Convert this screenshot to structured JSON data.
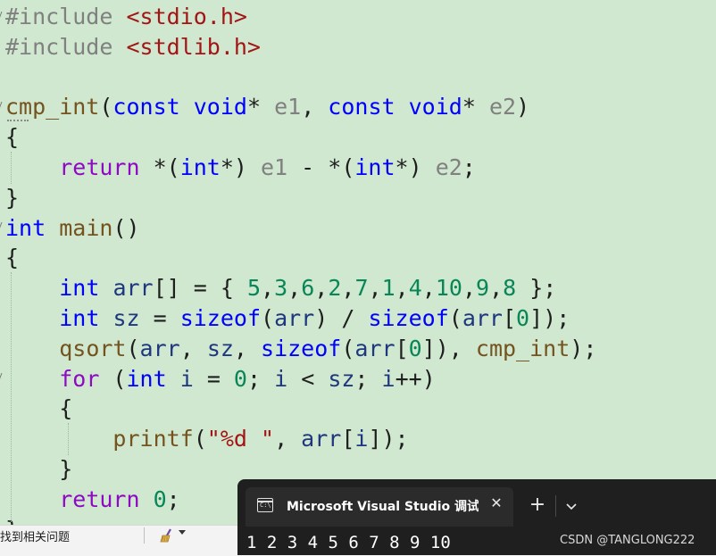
{
  "editor": {
    "lines": [
      [
        {
          "t": "#include ",
          "c": "pp"
        },
        {
          "t": "<stdio.h>",
          "c": "inc"
        }
      ],
      [
        {
          "t": "#include ",
          "c": "pp"
        },
        {
          "t": "<stdlib.h>",
          "c": "inc"
        }
      ],
      [],
      [
        {
          "t": "cmp_int",
          "c": "fn"
        },
        {
          "t": "(",
          "c": "op"
        },
        {
          "t": "const",
          "c": "kw"
        },
        {
          "t": " ",
          "c": "op"
        },
        {
          "t": "void",
          "c": "kw"
        },
        {
          "t": "* ",
          "c": "op"
        },
        {
          "t": "e1",
          "c": "param"
        },
        {
          "t": ", ",
          "c": "op"
        },
        {
          "t": "const",
          "c": "kw"
        },
        {
          "t": " ",
          "c": "op"
        },
        {
          "t": "void",
          "c": "kw"
        },
        {
          "t": "* ",
          "c": "op"
        },
        {
          "t": "e2",
          "c": "param"
        },
        {
          "t": ")",
          "c": "op"
        }
      ],
      [
        {
          "t": "{",
          "c": "op"
        }
      ],
      [
        {
          "t": "    ",
          "c": "op"
        },
        {
          "t": "return",
          "c": "ctl"
        },
        {
          "t": " *(",
          "c": "op"
        },
        {
          "t": "int",
          "c": "kw"
        },
        {
          "t": "*) ",
          "c": "op"
        },
        {
          "t": "e1",
          "c": "param"
        },
        {
          "t": " - *(",
          "c": "op"
        },
        {
          "t": "int",
          "c": "kw"
        },
        {
          "t": "*) ",
          "c": "op"
        },
        {
          "t": "e2",
          "c": "param"
        },
        {
          "t": ";",
          "c": "op"
        }
      ],
      [
        {
          "t": "}",
          "c": "op"
        }
      ],
      [
        {
          "t": "int",
          "c": "kw"
        },
        {
          "t": " ",
          "c": "op"
        },
        {
          "t": "main",
          "c": "fn"
        },
        {
          "t": "()",
          "c": "op"
        }
      ],
      [
        {
          "t": "{",
          "c": "op"
        }
      ],
      [
        {
          "t": "    ",
          "c": "op"
        },
        {
          "t": "int",
          "c": "kw"
        },
        {
          "t": " ",
          "c": "op"
        },
        {
          "t": "arr",
          "c": "var"
        },
        {
          "t": "[] = { ",
          "c": "op"
        },
        {
          "t": "5",
          "c": "num"
        },
        {
          "t": ",",
          "c": "op"
        },
        {
          "t": "3",
          "c": "num"
        },
        {
          "t": ",",
          "c": "op"
        },
        {
          "t": "6",
          "c": "num"
        },
        {
          "t": ",",
          "c": "op"
        },
        {
          "t": "2",
          "c": "num"
        },
        {
          "t": ",",
          "c": "op"
        },
        {
          "t": "7",
          "c": "num"
        },
        {
          "t": ",",
          "c": "op"
        },
        {
          "t": "1",
          "c": "num"
        },
        {
          "t": ",",
          "c": "op"
        },
        {
          "t": "4",
          "c": "num"
        },
        {
          "t": ",",
          "c": "op"
        },
        {
          "t": "10",
          "c": "num"
        },
        {
          "t": ",",
          "c": "op"
        },
        {
          "t": "9",
          "c": "num"
        },
        {
          "t": ",",
          "c": "op"
        },
        {
          "t": "8",
          "c": "num"
        },
        {
          "t": " };",
          "c": "op"
        }
      ],
      [
        {
          "t": "    ",
          "c": "op"
        },
        {
          "t": "int",
          "c": "kw"
        },
        {
          "t": " ",
          "c": "op"
        },
        {
          "t": "sz",
          "c": "var"
        },
        {
          "t": " = ",
          "c": "op"
        },
        {
          "t": "sizeof",
          "c": "kw"
        },
        {
          "t": "(",
          "c": "op"
        },
        {
          "t": "arr",
          "c": "var"
        },
        {
          "t": ") / ",
          "c": "op"
        },
        {
          "t": "sizeof",
          "c": "kw"
        },
        {
          "t": "(",
          "c": "op"
        },
        {
          "t": "arr",
          "c": "var"
        },
        {
          "t": "[",
          "c": "op"
        },
        {
          "t": "0",
          "c": "num"
        },
        {
          "t": "]);",
          "c": "op"
        }
      ],
      [
        {
          "t": "    ",
          "c": "op"
        },
        {
          "t": "qsort",
          "c": "fn"
        },
        {
          "t": "(",
          "c": "op"
        },
        {
          "t": "arr",
          "c": "var"
        },
        {
          "t": ", ",
          "c": "op"
        },
        {
          "t": "sz",
          "c": "var"
        },
        {
          "t": ", ",
          "c": "op"
        },
        {
          "t": "sizeof",
          "c": "kw"
        },
        {
          "t": "(",
          "c": "op"
        },
        {
          "t": "arr",
          "c": "var"
        },
        {
          "t": "[",
          "c": "op"
        },
        {
          "t": "0",
          "c": "num"
        },
        {
          "t": "]), ",
          "c": "op"
        },
        {
          "t": "cmp_int",
          "c": "fn"
        },
        {
          "t": ");",
          "c": "op"
        }
      ],
      [
        {
          "t": "    ",
          "c": "op"
        },
        {
          "t": "for",
          "c": "ctl"
        },
        {
          "t": " (",
          "c": "op"
        },
        {
          "t": "int",
          "c": "kw"
        },
        {
          "t": " ",
          "c": "op"
        },
        {
          "t": "i",
          "c": "var"
        },
        {
          "t": " = ",
          "c": "op"
        },
        {
          "t": "0",
          "c": "num"
        },
        {
          "t": "; ",
          "c": "op"
        },
        {
          "t": "i",
          "c": "var"
        },
        {
          "t": " < ",
          "c": "op"
        },
        {
          "t": "sz",
          "c": "var"
        },
        {
          "t": "; ",
          "c": "op"
        },
        {
          "t": "i",
          "c": "var"
        },
        {
          "t": "++)",
          "c": "op"
        }
      ],
      [
        {
          "t": "    {",
          "c": "op"
        }
      ],
      [
        {
          "t": "        ",
          "c": "op"
        },
        {
          "t": "printf",
          "c": "fn"
        },
        {
          "t": "(",
          "c": "op"
        },
        {
          "t": "\"%d \"",
          "c": "str"
        },
        {
          "t": ", ",
          "c": "op"
        },
        {
          "t": "arr",
          "c": "var"
        },
        {
          "t": "[",
          "c": "op"
        },
        {
          "t": "i",
          "c": "var"
        },
        {
          "t": "]);",
          "c": "op"
        }
      ],
      [
        {
          "t": "    }",
          "c": "op"
        }
      ],
      [
        {
          "t": "    ",
          "c": "op"
        },
        {
          "t": "return",
          "c": "ctl"
        },
        {
          "t": " ",
          "c": "op"
        },
        {
          "t": "0",
          "c": "num"
        },
        {
          "t": ";",
          "c": "op"
        }
      ],
      [
        {
          "t": "}",
          "c": "op"
        }
      ]
    ]
  },
  "statusbar": {
    "find_issues_label": "找到相关问题",
    "cleanup_icon": "broom-icon"
  },
  "console": {
    "tab_icon": "console-app-icon",
    "tab_title": "Microsoft Visual Studio 调试控制台",
    "close_glyph": "✕",
    "add_glyph": "+",
    "dropdown_icon": "chevron-down-icon",
    "output": "1 2 3 4 5 6 7 8 9 10"
  },
  "watermark": "CSDN @TANGLONG222",
  "colors": {
    "editor_bg": "#cfe8cf",
    "keyword": "#0000ff",
    "control": "#8f08c4",
    "function": "#74531f",
    "variable": "#1f377f",
    "parameter": "#808080",
    "string": "#a31515",
    "console_bg": "#1f1f1f"
  }
}
